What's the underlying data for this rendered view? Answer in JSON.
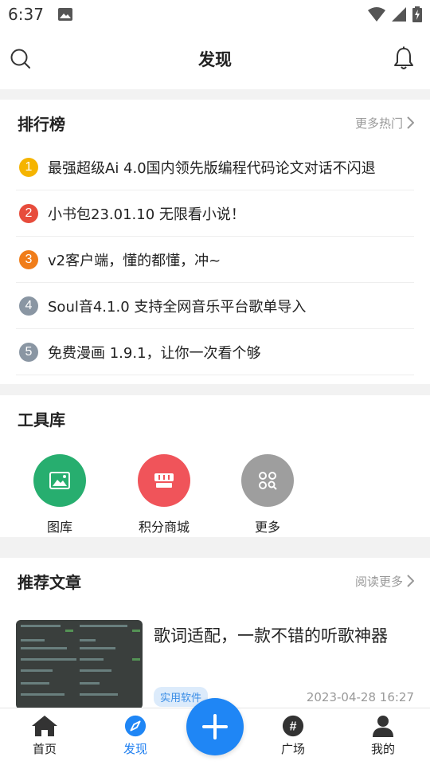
{
  "status_bar": {
    "time": "6:37"
  },
  "header": {
    "title": "发现"
  },
  "ranking": {
    "title": "排行榜",
    "more_label": "更多热门",
    "items": [
      {
        "rank": "1",
        "text": "最强超级Ai 4.0国内领先版编程代码论文对话不闪退",
        "color": "#f5b400"
      },
      {
        "rank": "2",
        "text": "小书包23.01.10 无限看小说！",
        "color": "#e74c3c"
      },
      {
        "rank": "3",
        "text": "v2客户端，懂的都懂，冲~",
        "color": "#f07d1a"
      },
      {
        "rank": "4",
        "text": "Soul音4.1.0 支持全网音乐平台歌单导入",
        "color": "#8a96a3"
      },
      {
        "rank": "5",
        "text": "免费漫画 1.9.1，让你一次看个够",
        "color": "#8a96a3"
      }
    ]
  },
  "tools": {
    "title": "工具库",
    "items": [
      {
        "label": "图库",
        "color": "#27ae6f",
        "icon": "image-icon"
      },
      {
        "label": "积分商城",
        "color": "#f0545a",
        "icon": "store-icon"
      },
      {
        "label": "更多",
        "color": "#9e9e9e",
        "icon": "more-apps-icon"
      }
    ]
  },
  "articles": {
    "title": "推荐文章",
    "more_label": "阅读更多",
    "items": [
      {
        "title": "歌词适配，一款不错的听歌神器",
        "tag": "实用软件",
        "date": "2023-04-28 16:27"
      }
    ]
  },
  "tabbar": {
    "items": [
      {
        "label": "首页",
        "icon": "home-icon"
      },
      {
        "label": "发现",
        "icon": "compass-icon",
        "active": true
      },
      {
        "label": "广场",
        "icon": "hashtag-icon"
      },
      {
        "label": "我的",
        "icon": "user-icon"
      }
    ],
    "accent": "#1f86f5"
  }
}
